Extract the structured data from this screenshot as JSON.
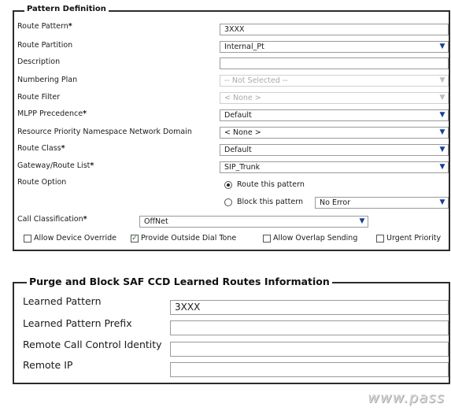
{
  "pattern_definition": {
    "legend": "Pattern Definition",
    "rows": [
      {
        "label": "Route Pattern",
        "required": true,
        "value": "3XXX"
      },
      {
        "label": "Route Partition",
        "required": false,
        "value": "Internal_Pt"
      },
      {
        "label": "Description",
        "required": false,
        "value": ""
      },
      {
        "label": "Numbering Plan",
        "required": false,
        "value": "-- Not Selected --"
      },
      {
        "label": "Route Filter",
        "required": false,
        "value": "< None >"
      },
      {
        "label": "MLPP Precedence",
        "required": true,
        "value": "Default"
      },
      {
        "label": "Resource Priority Namespace Network Domain",
        "required": false,
        "value": "< None >"
      },
      {
        "label": "Route Class",
        "required": true,
        "value": "Default"
      },
      {
        "label": "Gateway/Route List",
        "required": true,
        "value": "SIP_Trunk"
      }
    ],
    "route_option": {
      "label": "Route Option",
      "option_route": "Route this pattern",
      "option_block": "Block this pattern",
      "block_reason": "No Error",
      "selected": "route"
    },
    "call_classification": {
      "label": "Call Classification",
      "required": true,
      "value": "OffNet"
    },
    "checkboxes": [
      {
        "label": "Allow Device Override",
        "checked": false
      },
      {
        "label": "Provide Outside Dial Tone",
        "checked": true
      },
      {
        "label": "Allow Overlap Sending",
        "checked": false
      },
      {
        "label": "Urgent Priority",
        "checked": false
      }
    ],
    "required_mark": "*"
  },
  "saf": {
    "legend": "Purge and Block SAF CCD Learned Routes Information",
    "rows": [
      {
        "label": "Learned Pattern",
        "value": "3XXX"
      },
      {
        "label": "Learned Pattern Prefix",
        "value": ""
      },
      {
        "label": "Remote Call Control Identity",
        "value": ""
      },
      {
        "label": "Remote IP",
        "value": ""
      }
    ]
  },
  "watermark": "www.pass"
}
